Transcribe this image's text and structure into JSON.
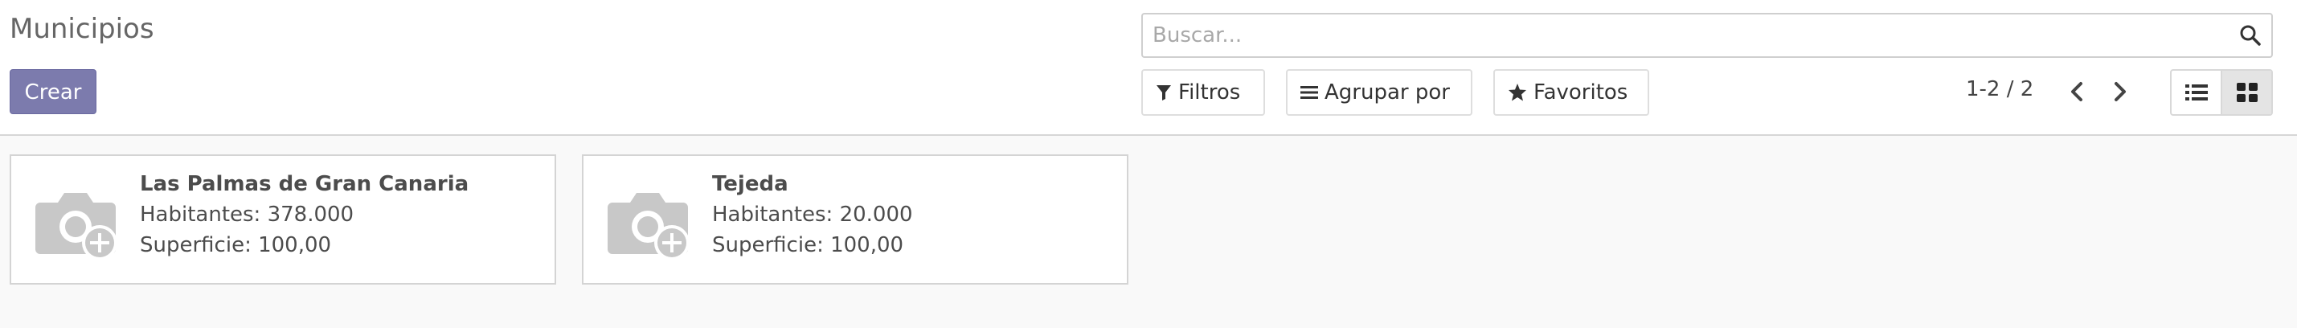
{
  "page": {
    "title": "Municipios"
  },
  "actions": {
    "create_label": "Crear"
  },
  "search": {
    "placeholder": "Buscar..."
  },
  "filters": {
    "filters_label": "Filtros",
    "group_by_label": "Agrupar por",
    "favorites_label": "Favoritos"
  },
  "pager": {
    "range": "1-2 / 2"
  },
  "views": [
    "list-view",
    "kanban-view"
  ],
  "active_view": "kanban-view",
  "records": [
    {
      "name": "Las Palmas de Gran Canaria",
      "habitantes": "Habitantes: 378.000",
      "superficie": "Superficie: 100,00"
    },
    {
      "name": "Tejeda",
      "habitantes": "Habitantes: 20.000",
      "superficie": "Superficie: 100,00"
    }
  ],
  "colors": {
    "primary": "#7c7bad",
    "background": "#f9f9f9",
    "card_border": "#d4d4d4"
  }
}
